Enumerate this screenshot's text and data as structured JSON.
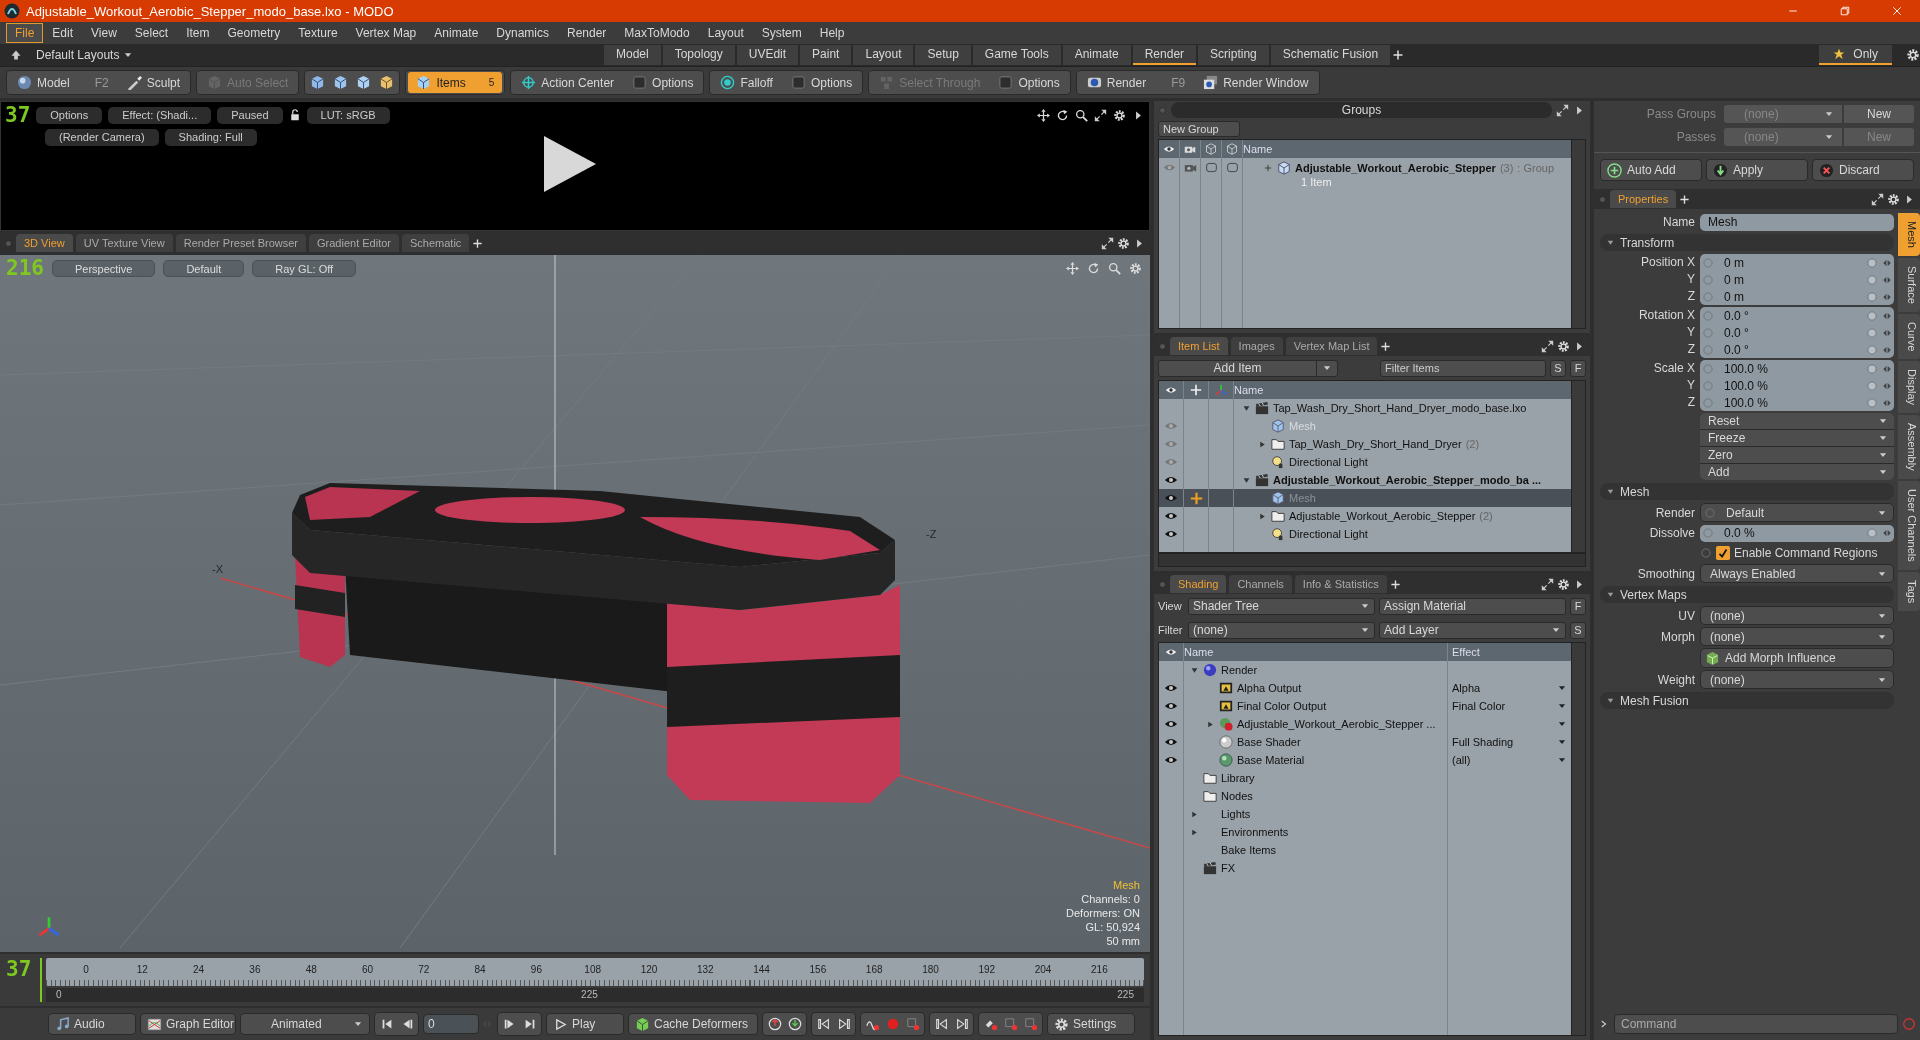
{
  "window": {
    "title": "Adjustable_Workout_Aerobic_Stepper_modo_base.lxo - MODO"
  },
  "menu": [
    {
      "label": "File",
      "selected": true
    },
    {
      "label": "Edit",
      "selected": false
    },
    {
      "label": "View",
      "selected": false
    },
    {
      "label": "Select",
      "selected": false
    },
    {
      "label": "Item",
      "selected": false
    },
    {
      "label": "Geometry",
      "selected": false
    },
    {
      "label": "Texture",
      "selected": false
    },
    {
      "label": "Vertex Map",
      "selected": false
    },
    {
      "label": "Animate",
      "selected": false
    },
    {
      "label": "Dynamics",
      "selected": false
    },
    {
      "label": "Render",
      "selected": false
    },
    {
      "label": "MaxToModo",
      "selected": false
    },
    {
      "label": "Layout",
      "selected": false
    },
    {
      "label": "System",
      "selected": false
    },
    {
      "label": "Help",
      "selected": false
    }
  ],
  "layouts": {
    "label": "Default Layouts"
  },
  "layout_tabs": [
    {
      "label": "Model",
      "selected": false
    },
    {
      "label": "Topology",
      "selected": false
    },
    {
      "label": "UVEdit",
      "selected": false
    },
    {
      "label": "Paint",
      "selected": false
    },
    {
      "label": "Layout",
      "selected": false
    },
    {
      "label": "Setup",
      "selected": false
    },
    {
      "label": "Game Tools",
      "selected": false
    },
    {
      "label": "Animate",
      "selected": false
    },
    {
      "label": "Render",
      "selected": true
    },
    {
      "label": "Scripting",
      "selected": false
    },
    {
      "label": "Schematic Fusion",
      "selected": false
    }
  ],
  "only_button": {
    "label": "Only"
  },
  "toolbar": [
    {
      "items": [
        {
          "kind": "mode",
          "label": "Model",
          "shortcut": "F2",
          "selected": false,
          "disabled": false
        },
        {
          "kind": "brush",
          "label": "Sculpt",
          "selected": false,
          "disabled": false
        }
      ]
    },
    {
      "items": [
        {
          "kind": "select",
          "label": "Auto Select",
          "selected": false,
          "disabled": true
        }
      ]
    },
    {
      "items": [
        {
          "kind": "vertex",
          "selected": false,
          "disabled": false
        },
        {
          "kind": "edge",
          "selected": false,
          "disabled": false
        },
        {
          "kind": "polygon",
          "selected": false,
          "disabled": false
        },
        {
          "kind": "material",
          "selected": false,
          "disabled": false
        }
      ]
    },
    {
      "items": [
        {
          "kind": "items",
          "label": "Items",
          "badge": "5",
          "selected": true,
          "disabled": false
        }
      ]
    },
    {
      "items": [
        {
          "kind": "center",
          "label": "Action Center",
          "selected": false,
          "disabled": false
        },
        {
          "kind": "option",
          "label": "Options",
          "selected": false,
          "disabled": false
        }
      ]
    },
    {
      "items": [
        {
          "kind": "falloff",
          "label": "Falloff",
          "selected": false,
          "disabled": false
        },
        {
          "kind": "option",
          "label": "Options",
          "selected": false,
          "disabled": false
        }
      ]
    },
    {
      "items": [
        {
          "kind": "through",
          "label": "Select Through",
          "selected": false,
          "disabled": true
        },
        {
          "kind": "option",
          "label": "Options",
          "selected": false,
          "disabled": false
        }
      ]
    },
    {
      "items": [
        {
          "kind": "render",
          "label": "Render",
          "shortcut": "F9",
          "selected": false,
          "disabled": false
        },
        {
          "kind": "render_window",
          "label": "Render Window",
          "selected": false,
          "disabled": false
        }
      ]
    }
  ],
  "preview": {
    "frame": "37",
    "chips": [
      "Options",
      "Effect: (Shadi...",
      "Paused",
      "LUT: sRGB"
    ],
    "chips_row2": [
      "(Render Camera)",
      "Shading: Full"
    ]
  },
  "viewport_tabs": [
    {
      "label": "3D View",
      "selected": true
    },
    {
      "label": "UV Texture View",
      "selected": false
    },
    {
      "label": "Render Preset Browser",
      "selected": false
    },
    {
      "label": "Gradient Editor",
      "selected": false
    },
    {
      "label": "Schematic",
      "selected": false
    }
  ],
  "viewport": {
    "frame": "216",
    "chips": [
      "Perspective",
      "Default",
      "Ray GL: Off"
    ],
    "axis_labels": [
      "-X",
      "-Z"
    ],
    "info_title": "Mesh",
    "info": [
      "Channels: 0",
      "Deformers: ON",
      "GL: 50,924",
      "50 mm"
    ]
  },
  "timeline": {
    "frame": "37",
    "ticks": [
      "0",
      "12",
      "24",
      "36",
      "48",
      "60",
      "72",
      "84",
      "96",
      "108",
      "120",
      "132",
      "144",
      "156",
      "168",
      "180",
      "192",
      "204",
      "216"
    ],
    "range_start": "0",
    "range_mid": "225",
    "range_end": "225"
  },
  "transport": {
    "audio": "Audio",
    "graph_editor": "Graph Editor",
    "mode": "Animated",
    "frame": "0",
    "play": "Play",
    "cache": "Cache Deformers",
    "settings": "Settings"
  },
  "groups": {
    "title": "Groups",
    "new_button": "New Group",
    "column": "Name",
    "rows": [
      {
        "name": "Adjustable_Workout_Aerobic_Stepper",
        "count": "(3)",
        "type": ": Group",
        "sub": "1 Item"
      }
    ]
  },
  "item_list": {
    "tabs": [
      {
        "label": "Item List",
        "selected": true
      },
      {
        "label": "Images",
        "selected": false
      },
      {
        "label": "Vertex Map List",
        "selected": false
      }
    ],
    "add_item": "Add Item",
    "filter_placeholder": "Filter Items",
    "buttons": [
      "S",
      "F"
    ],
    "column": "Name",
    "tree": [
      {
        "name": "Tap_Wash_Dry_Short_Hand_Dryer_modo_base.lxo",
        "kind": "scene",
        "expanded": true,
        "selected": false,
        "active": false,
        "children": [
          {
            "name": "Mesh",
            "kind": "mesh",
            "visible": false,
            "disabled": true,
            "selected": false
          },
          {
            "name": "Tap_Wash_Dry_Short_Hand_Dryer",
            "count": "(2)",
            "kind": "folder",
            "visible": false,
            "expanded": false,
            "selected": false
          },
          {
            "name": "Directional Light",
            "kind": "light",
            "visible": false,
            "selected": false
          }
        ]
      },
      {
        "name": "Adjustable_Workout_Aerobic_Stepper_modo_ba ...",
        "kind": "scene",
        "visible": true,
        "expanded": true,
        "selected": false,
        "active": true,
        "children": [
          {
            "name": "Mesh",
            "kind": "mesh",
            "visible": true,
            "disabled": true,
            "selected": true
          },
          {
            "name": "Adjustable_Workout_Aerobic_Stepper",
            "count": "(2)",
            "kind": "folder",
            "visible": true,
            "expanded": false,
            "selected": false
          },
          {
            "name": "Directional Light",
            "kind": "light",
            "visible": true,
            "selected": false
          }
        ]
      }
    ]
  },
  "shading": {
    "tabs": [
      {
        "label": "Shading",
        "selected": true
      },
      {
        "label": "Channels",
        "selected": false
      },
      {
        "label": "Info & Statistics",
        "selected": false
      }
    ],
    "view_label": "View",
    "view_value": "Shader Tree",
    "assign": "Assign Material",
    "assign_key": "F",
    "filter_label": "Filter",
    "filter_value": "(none)",
    "add_layer": "Add Layer",
    "add_key": "S",
    "columns": [
      "Name",
      "Effect"
    ],
    "tree": [
      {
        "name": "Render",
        "kind": "render",
        "expanded": true,
        "children": [
          {
            "name": "Alpha Output",
            "kind": "output",
            "visible": true,
            "effect": "Alpha"
          },
          {
            "name": "Final Color Output",
            "kind": "output",
            "visible": true,
            "effect": "Final Color"
          },
          {
            "name": "Adjustable_Workout_Aerobic_Stepper ...",
            "kind": "material_group",
            "visible": true,
            "expanded": false
          },
          {
            "name": "Base Shader",
            "kind": "shader",
            "visible": true,
            "effect": "Full Shading"
          },
          {
            "name": "Base Material",
            "kind": "material",
            "visible": true,
            "effect": "(all)"
          }
        ]
      },
      {
        "name": "Library",
        "kind": "folder"
      },
      {
        "name": "Nodes",
        "kind": "folder"
      },
      {
        "name": "Lights",
        "kind": "category",
        "expanded": false
      },
      {
        "name": "Environments",
        "kind": "category",
        "expanded": false
      },
      {
        "name": "Bake Items",
        "kind": "category"
      },
      {
        "name": "FX",
        "kind": "fx"
      }
    ]
  },
  "passes": [
    {
      "label": "Pass Groups",
      "value": "(none)",
      "button": "New",
      "disabled": false
    },
    {
      "label": "Passes",
      "value": "(none)",
      "button": "New",
      "disabled": true
    }
  ],
  "actions": [
    {
      "kind": "add",
      "label": "Auto Add"
    },
    {
      "kind": "apply",
      "label": "Apply"
    },
    {
      "kind": "discard",
      "label": "Discard"
    }
  ],
  "properties": {
    "tabs": [
      {
        "label": "Properties",
        "selected": true
      }
    ],
    "side_tabs": [
      {
        "label": "Mesh",
        "selected": true
      },
      {
        "label": "Surface",
        "selected": false
      },
      {
        "label": "Curve",
        "selected": false
      },
      {
        "label": "Display",
        "selected": false
      },
      {
        "label": "Assembly",
        "selected": false
      },
      {
        "label": "User Channels",
        "selected": false
      },
      {
        "label": "Tags",
        "selected": false
      }
    ],
    "name_label": "Name",
    "name_value": "Mesh",
    "sections": [
      {
        "title": "Transform",
        "rows": [
          {
            "kind": "vector",
            "fields": [
              {
                "label": "Position X",
                "value": "0 m"
              },
              {
                "label": "Y",
                "value": "0 m"
              },
              {
                "label": "Z",
                "value": "0 m"
              }
            ]
          },
          {
            "kind": "vector",
            "fields": [
              {
                "label": "Rotation X",
                "value": "0.0 °"
              },
              {
                "label": "Y",
                "value": "0.0 °"
              },
              {
                "label": "Z",
                "value": "0.0 °"
              }
            ]
          },
          {
            "kind": "vector",
            "fields": [
              {
                "label": "Scale X",
                "value": "100.0 %"
              },
              {
                "label": "Y",
                "value": "100.0 %"
              },
              {
                "label": "Z",
                "value": "100.0 %"
              }
            ]
          },
          {
            "kind": "menu_stack",
            "items": [
              "Reset",
              "Freeze",
              "Zero",
              "Add"
            ]
          }
        ]
      },
      {
        "title": "Mesh",
        "rows": [
          {
            "kind": "channel_dropdown",
            "label": "Render",
            "value": "Default"
          },
          {
            "kind": "field",
            "label": "Dissolve",
            "value": "0.0 %"
          },
          {
            "kind": "checkbox",
            "label": "Enable Command Regions",
            "checked": true
          },
          {
            "kind": "dropdown",
            "label": "Smoothing",
            "value": "Always Enabled"
          }
        ]
      },
      {
        "title": "Vertex Maps",
        "rows": [
          {
            "kind": "dropdown",
            "label": "UV",
            "value": "(none)"
          },
          {
            "kind": "dropdown",
            "label": "Morph",
            "value": "(none)"
          },
          {
            "kind": "button",
            "label": "Add Morph Influence"
          },
          {
            "kind": "dropdown",
            "label": "Weight",
            "value": "(none)"
          }
        ]
      },
      {
        "title": "Mesh Fusion"
      }
    ]
  },
  "command": {
    "placeholder": "Command"
  }
}
